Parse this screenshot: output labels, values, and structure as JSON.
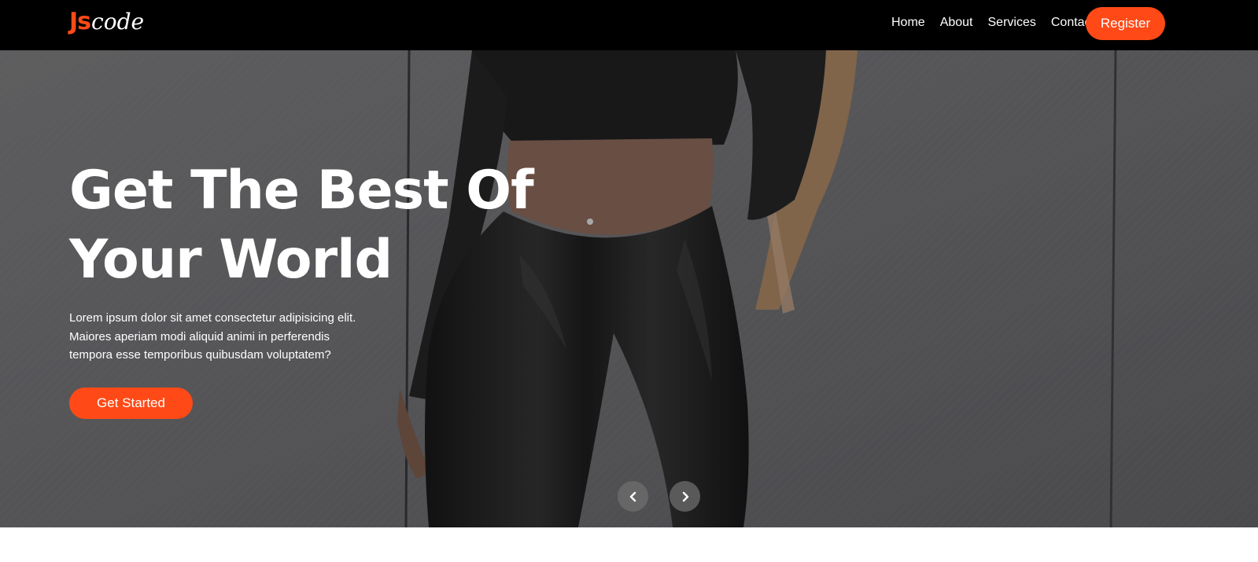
{
  "brand": {
    "logo_part1": "Js",
    "logo_part2": "code",
    "accent_color": "#ff4a17"
  },
  "nav": {
    "items": [
      {
        "label": "Home"
      },
      {
        "label": "About"
      },
      {
        "label": "Services"
      },
      {
        "label": "Contact"
      }
    ],
    "register_label": "Register"
  },
  "hero": {
    "title_line1": "Get The Best Of",
    "title_line2": "Your World",
    "description_line1": "Lorem ipsum dolor sit amet consectetur adipisicing elit.",
    "description_line2": "Maiores aperiam modi aliquid animi in perferendis",
    "description_line3": "tempora esse temporibus quibusdam voluptatem?",
    "cta_label": "Get Started",
    "prev_icon": "chevron-left-icon",
    "next_icon": "chevron-right-icon"
  }
}
